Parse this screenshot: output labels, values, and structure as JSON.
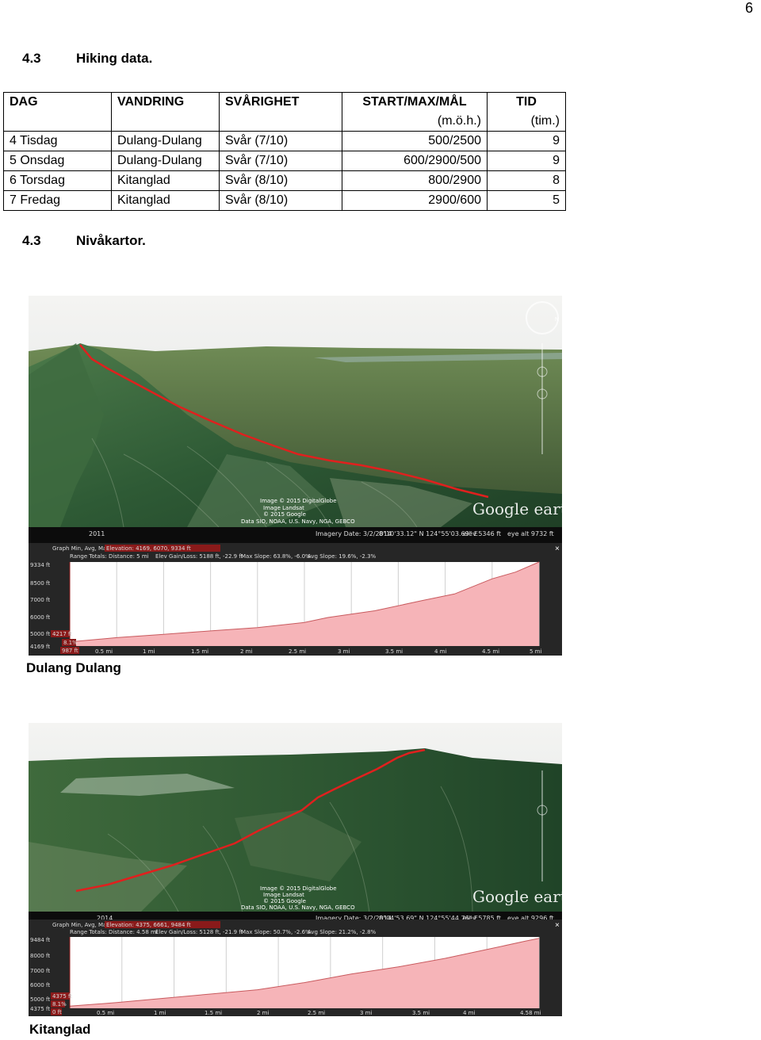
{
  "page_number": "6",
  "section1": {
    "number": "4.3",
    "title": "Hiking data."
  },
  "table": {
    "headers": [
      "DAG",
      "VANDRING",
      "SVÅRIGHET",
      "START/MAX/MÅL",
      "TID"
    ],
    "subheaders": [
      "",
      "",
      "",
      "(m.ö.h.)",
      "(tim.)"
    ],
    "rows": [
      [
        "4 Tisdag",
        "Dulang-Dulang",
        "Svår  (7/10)",
        "500/2500",
        "9"
      ],
      [
        "5 Onsdag",
        "Dulang-Dulang",
        "Svår (7/10)",
        "600/2900/500",
        "9"
      ],
      [
        "6 Torsdag",
        "Kitanglad",
        "Svår (8/10)",
        "800/2900",
        "8"
      ],
      [
        "7 Fredag",
        "Kitanglad",
        "Svår (8/10)",
        "2900/600",
        "5"
      ]
    ]
  },
  "section2": {
    "number": "4.3",
    "title": "Nivåkartor."
  },
  "maps": [
    {
      "caption": "Dulang Dulang",
      "credits": [
        "Image © 2015 DigitalGlobe",
        "Image Landsat",
        "© 2015 Google",
        "Data SIO, NOAA, U.S. Navy, NGA, GEBCO"
      ],
      "logo": "Google earth",
      "year_badge": "2011",
      "status": {
        "imagery_date": "Imagery Date: 3/2/2014",
        "coords": "8°10'33.12\" N  124°55'03.69\" E",
        "elev": "elev  5346 ft",
        "eye_alt": "eye alt  9732 ft"
      },
      "graph_header": {
        "label": "Graph  Min, Avg, Max:",
        "elevation": "Elevation: 4169, 6070, 9334 ft",
        "range_totals": "Range Totals:  Distance: 5 mi",
        "elev_gain": "Elev Gain/Loss: 5188 ft, -22.9 ft",
        "max_slope": "Max Slope: 63.8%, -6.0%",
        "avg_slope": "Avg Slope: 19.6%, -2.3%"
      },
      "y_ticks": [
        "9334 ft",
        "8500 ft",
        "7000 ft",
        "6000 ft",
        "5000 ft",
        "4169 ft"
      ],
      "x_ticks": [
        "0.5 mi",
        "1 mi",
        "1.5 mi",
        "2 mi",
        "2.5 mi",
        "3 mi",
        "3.5 mi",
        "4 mi",
        "4.5 mi",
        "5 mi"
      ],
      "marker": {
        "elev": "4217 ft",
        "slope": "8.1%",
        "dist": "987 ft"
      }
    },
    {
      "caption": "Kitanglad",
      "credits": [
        "Image © 2015 DigitalGlobe",
        "Image Landsat",
        "© 2015 Google",
        "Data SIO, NOAA, U.S. Navy, NGA, GEBCO"
      ],
      "logo": "Google earth",
      "year_badge": "2014",
      "status": {
        "imagery_date": "Imagery Date: 3/2/2014",
        "coords": "8°04'53.69\" N  124°55'44.76\" E",
        "elev": "elev  5785 ft",
        "eye_alt": "eye alt  9296 ft"
      },
      "graph_header": {
        "label": "Graph  Min, Avg, Max:",
        "elevation": "Elevation: 4375, 6661, 9484 ft",
        "range_totals": "Range Totals:  Distance: 4.58 mi",
        "elev_gain": "Elev Gain/Loss: 5128 ft, -21.9 ft",
        "max_slope": "Max Slope: 50.7%, -2.6%",
        "avg_slope": "Avg Slope: 21.2%, -2.8%"
      },
      "y_ticks": [
        "9484 ft",
        "8000 ft",
        "7000 ft",
        "6000 ft",
        "5000 ft",
        "4375 ft"
      ],
      "x_ticks": [
        "0.5 mi",
        "1 mi",
        "1.5 mi",
        "2 mi",
        "2.5 mi",
        "3 mi",
        "3.5 mi",
        "4 mi",
        "4.58 mi"
      ],
      "marker": {
        "elev": "4375 ft",
        "slope": "8.1%",
        "dist": "0 ft"
      }
    }
  ],
  "colors": {
    "track": "#e0201e",
    "profile_fill": "#f6b4b8",
    "profile_line": "#ffffff"
  }
}
